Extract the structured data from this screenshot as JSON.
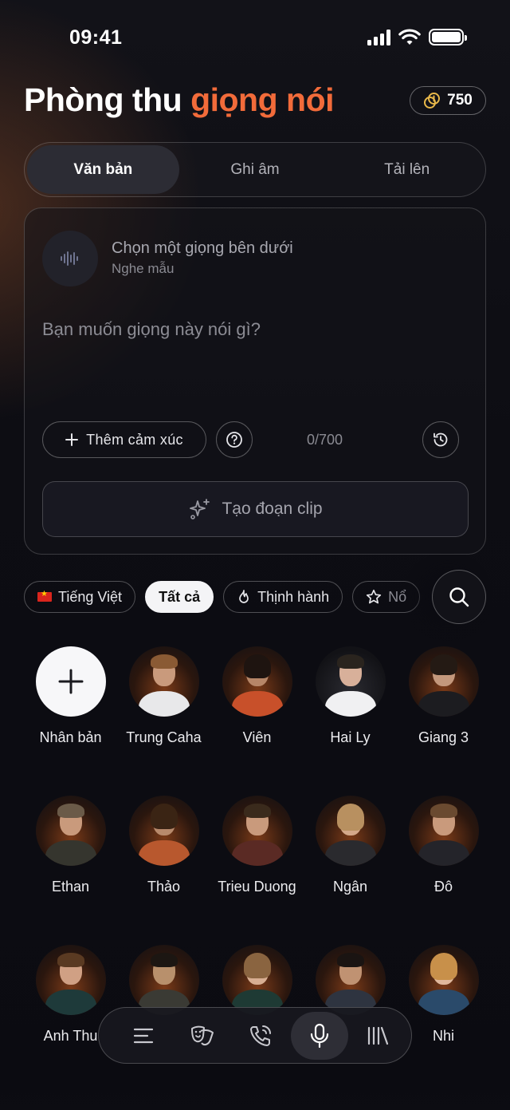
{
  "status_bar": {
    "time": "09:41"
  },
  "header": {
    "title_main": "Phòng thu",
    "title_accent": "giọng nói",
    "credits": "750",
    "accent_color": "#f26b3a"
  },
  "tabs": [
    {
      "label": "Văn bản",
      "active": true
    },
    {
      "label": "Ghi âm",
      "active": false
    },
    {
      "label": "Tải lên",
      "active": false
    }
  ],
  "composer": {
    "voice_title": "Chọn một giọng bên dưới",
    "voice_subtitle": "Nghe mẫu",
    "placeholder": "Bạn muốn giọng này nói gì?",
    "emotion_button": "Thêm cảm xúc",
    "char_count": "0/700",
    "create_button": "Tạo đoạn clip"
  },
  "filters": {
    "language": "Tiếng Việt",
    "all": "Tất cả",
    "trending": "Thịnh hành",
    "featured_partial": "Nổ"
  },
  "voices": [
    {
      "name": "Nhân bản",
      "type": "add"
    },
    {
      "name": "Trung Caha"
    },
    {
      "name": "Viên"
    },
    {
      "name": "Hai Ly"
    },
    {
      "name": "Giang 3"
    },
    {
      "name": "Ethan"
    },
    {
      "name": "Thảo"
    },
    {
      "name": "Trieu Duong"
    },
    {
      "name": "Ngân"
    },
    {
      "name": "Đô"
    },
    {
      "name": "Anh Thu"
    },
    {
      "name": ""
    },
    {
      "name": ""
    },
    {
      "name": ""
    },
    {
      "name": "Nhi"
    }
  ],
  "bottom_nav": [
    {
      "icon": "menu-icon",
      "active": false
    },
    {
      "icon": "theater-masks-icon",
      "active": false
    },
    {
      "icon": "phone-call-icon",
      "active": false
    },
    {
      "icon": "microphone-icon",
      "active": true
    },
    {
      "icon": "library-icon",
      "active": false
    }
  ]
}
